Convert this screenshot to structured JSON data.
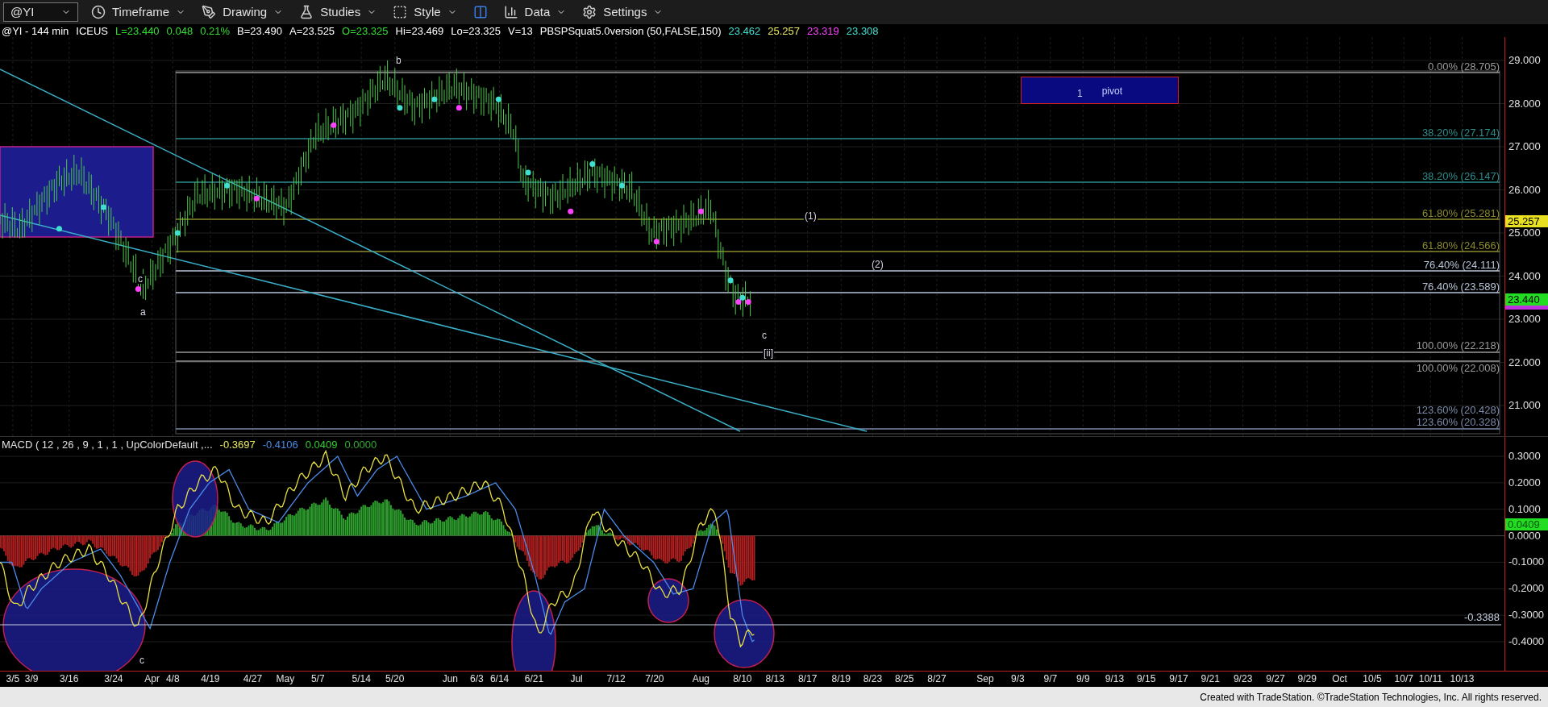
{
  "toolbar": {
    "symbol": "@YI",
    "buttons": [
      {
        "kind": "timeframe",
        "label": "Timeframe"
      },
      {
        "kind": "drawing",
        "label": "Drawing"
      },
      {
        "kind": "studies",
        "label": "Studies"
      },
      {
        "kind": "style",
        "label": "Style"
      },
      {
        "kind": "layout"
      },
      {
        "kind": "data",
        "label": "Data"
      },
      {
        "kind": "settings",
        "label": "Settings"
      }
    ]
  },
  "legend": [
    {
      "text": "@YI - 144 min",
      "color": "#ffffff"
    },
    {
      "text": "ICEUS",
      "color": "#ffffff"
    },
    {
      "text": "L=23.440",
      "color": "#33dd33"
    },
    {
      "text": "0.048",
      "color": "#33dd33"
    },
    {
      "text": "0.21%",
      "color": "#33dd33"
    },
    {
      "text": "B=23.490",
      "color": "#ffffff"
    },
    {
      "text": "A=23.525",
      "color": "#ffffff"
    },
    {
      "text": "O=23.325",
      "color": "#33dd33"
    },
    {
      "text": "Hi=23.469",
      "color": "#ffffff"
    },
    {
      "text": "Lo=23.325",
      "color": "#ffffff"
    },
    {
      "text": "V=13",
      "color": "#ffffff"
    },
    {
      "text": "PBSPSquat5.0version (50,FALSE,150)",
      "color": "#ffffff"
    },
    {
      "text": "23.462",
      "color": "#40e0d0"
    },
    {
      "text": "25.257",
      "color": "#e8e860"
    },
    {
      "text": "23.319",
      "color": "#ff40ff"
    },
    {
      "text": "23.308",
      "color": "#40e0d0"
    }
  ],
  "price_pane": {
    "wave_labels": [
      "b",
      "c",
      "a",
      "(1)",
      "(2)",
      "c",
      "[ii]"
    ],
    "pivot_box": {
      "number": "1",
      "label": "pivot"
    },
    "fib_levels": [
      {
        "label": "0.00% (28.705)",
        "color": "#9a9a9a"
      },
      {
        "label": "38.20% (27.174)",
        "color": "#2e8b8b"
      },
      {
        "label": "38.20% (26.147)",
        "color": "#2e8b8b"
      },
      {
        "label": "61.80% (25.281)",
        "color": "#8b8b2e"
      },
      {
        "label": "61.80% (24.566)",
        "color": "#8b8b2e"
      },
      {
        "label": "76.40% (24.111)",
        "color": "#b8c4d8"
      },
      {
        "label": "76.40% (23.589)",
        "color": "#b8c4d8"
      },
      {
        "label": "100.00% (22.218)",
        "color": "#9a9a9a"
      },
      {
        "label": "100.00% (22.008)",
        "color": "#9a9a9a"
      },
      {
        "label": "123.60% (20.428)",
        "color": "#7a8aa8"
      },
      {
        "label": "123.60% (20.328)",
        "color": "#7a8aa8"
      }
    ],
    "axis_labels": [
      "29.000",
      "28.000",
      "27.000",
      "26.000",
      "25.000",
      "24.000",
      "23.000",
      "22.000",
      "21.000"
    ],
    "price_tags": [
      {
        "text": "25.257",
        "color": "#e8e020"
      },
      {
        "text": "23.440",
        "color": "#22dd22"
      }
    ]
  },
  "macd_pane": {
    "title": "MACD ( 12 , 26 , 9 , 1 , 1 , UpColorDefault ,...",
    "values": [
      {
        "text": "-0.3697",
        "color": "#e8e860"
      },
      {
        "text": "-0.4106",
        "color": "#4a8ae8"
      },
      {
        "text": "0.0409",
        "color": "#33cc33"
      },
      {
        "text": "0.0000",
        "color": "#33aa33"
      }
    ],
    "wave_label": "c",
    "level_label": "-0.3388",
    "axis_labels": [
      "0.3000",
      "0.2000",
      "0.1000",
      "0.0000",
      "-0.1000",
      "-0.2000",
      "-0.3000",
      "-0.4000"
    ],
    "value_tag": {
      "text": "0.0409",
      "color": "#22dd22"
    }
  },
  "date_axis": [
    "3/5",
    "3/9",
    "3/16",
    "3/24",
    "Apr",
    "4/8",
    "4/19",
    "4/27",
    "May",
    "5/7",
    "5/14",
    "5/20",
    "Jun",
    "6/3",
    "6/14",
    "6/21",
    "Jul",
    "7/12",
    "7/20",
    "Aug",
    "8/10",
    "8/13",
    "8/17",
    "8/19",
    "8/23",
    "8/25",
    "8/27",
    "Sep",
    "9/3",
    "9/7",
    "9/9",
    "9/13",
    "9/15",
    "9/17",
    "9/21",
    "9/23",
    "9/27",
    "9/29",
    "Oct",
    "10/5",
    "10/7",
    "10/11",
    "10/13"
  ],
  "footer": "Created with TradeStation. ©TradeStation Technologies, Inc. All rights reserved."
}
